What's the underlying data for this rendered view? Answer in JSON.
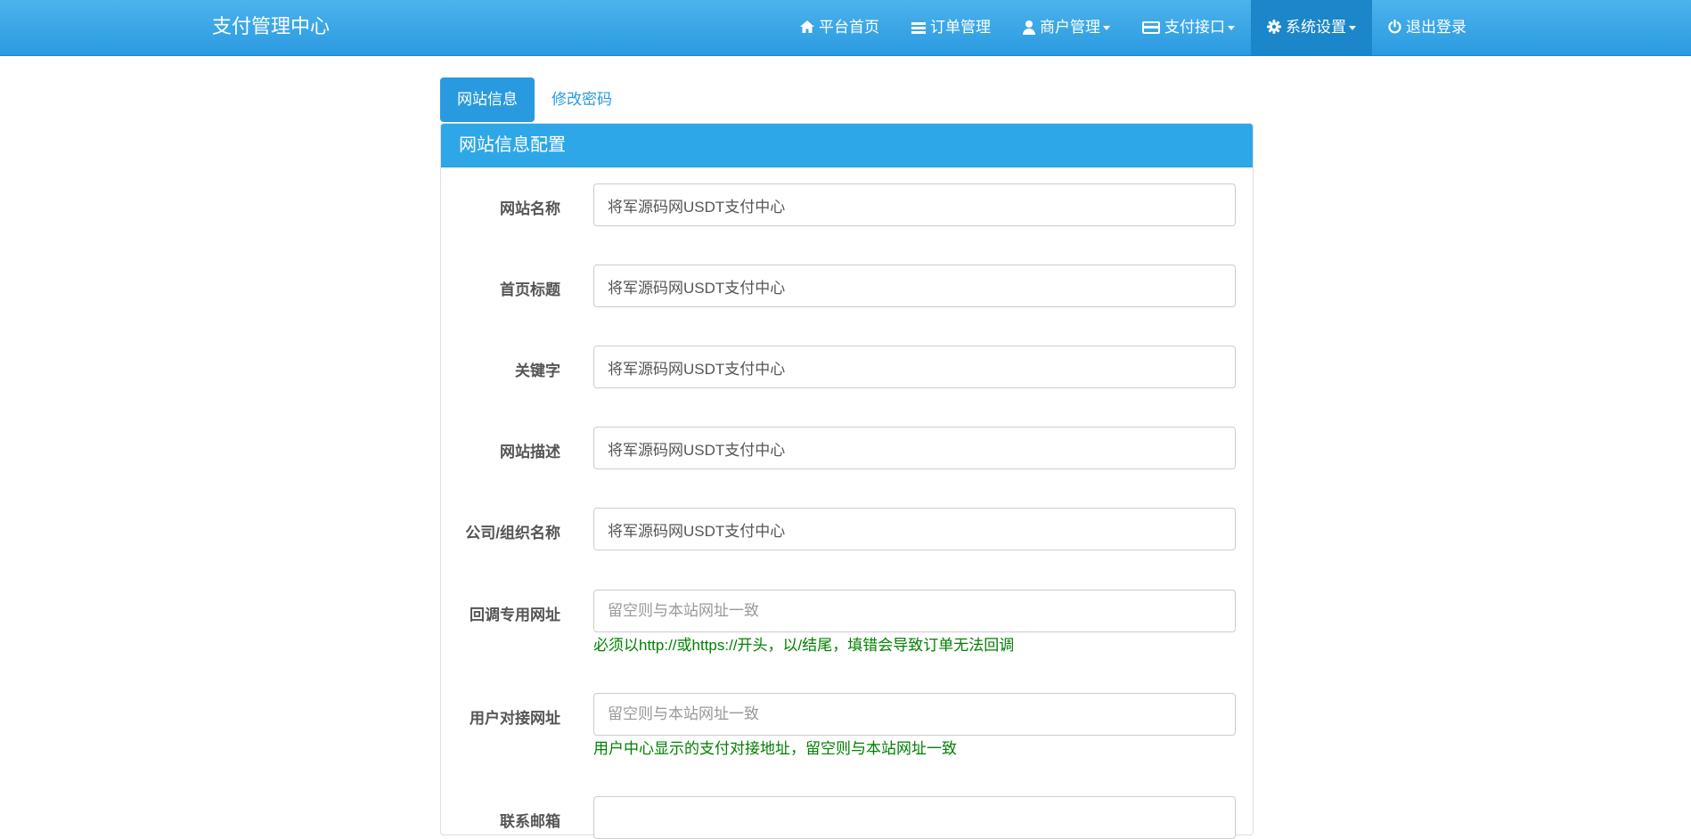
{
  "navbar": {
    "brand": "支付管理中心",
    "items": [
      {
        "label": "平台首页",
        "icon": "home-icon"
      },
      {
        "label": "订单管理",
        "icon": "list-icon"
      },
      {
        "label": "商户管理",
        "icon": "user-icon",
        "dropdown": true
      },
      {
        "label": "支付接口",
        "icon": "credit-card-icon",
        "dropdown": true
      },
      {
        "label": "系统设置",
        "icon": "gear-icon",
        "dropdown": true,
        "active": true
      },
      {
        "label": "退出登录",
        "icon": "power-icon"
      }
    ]
  },
  "tabs": [
    {
      "label": "网站信息",
      "active": true
    },
    {
      "label": "修改密码",
      "active": false
    }
  ],
  "panel": {
    "title": "网站信息配置",
    "fields": [
      {
        "label": "网站名称",
        "value": "将军源码网USDT支付中心",
        "placeholder": ""
      },
      {
        "label": "首页标题",
        "value": "将军源码网USDT支付中心",
        "placeholder": ""
      },
      {
        "label": "关键字",
        "value": "将军源码网USDT支付中心",
        "placeholder": ""
      },
      {
        "label": "网站描述",
        "value": "将军源码网USDT支付中心",
        "placeholder": ""
      },
      {
        "label": "公司/组织名称",
        "value": "将军源码网USDT支付中心",
        "placeholder": ""
      },
      {
        "label": "回调专用网址",
        "value": "",
        "placeholder": "留空则与本站网址一致",
        "help": "必须以http://或https://开头，以/结尾，填错会导致订单无法回调"
      },
      {
        "label": "用户对接网址",
        "value": "",
        "placeholder": "留空则与本站网址一致",
        "help": "用户中心显示的支付对接地址，留空则与本站网址一致"
      },
      {
        "label": "联系邮箱",
        "value": "",
        "placeholder": ""
      }
    ]
  },
  "colors": {
    "navbar": "#2a9ae0",
    "navbar_active": "#1b86c9",
    "panel_heading": "#2ea7e8",
    "help_text": "#008000"
  }
}
